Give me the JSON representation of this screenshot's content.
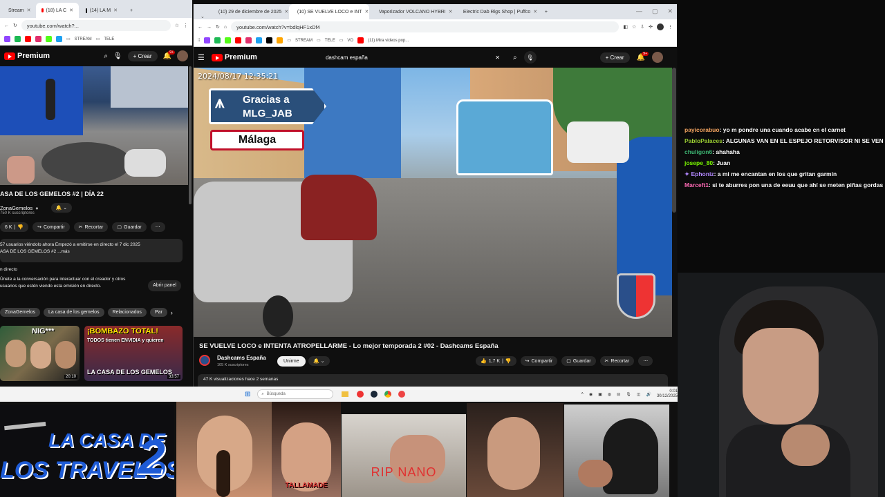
{
  "left_browser": {
    "tabs": [
      {
        "label": "Stream"
      },
      {
        "label": "(18) LA C"
      },
      {
        "label": "(14) LA M"
      }
    ],
    "url": "youtube.com/watch?...",
    "bookmarks": [
      "STREAM",
      "TELE"
    ],
    "header": {
      "logo": "Premium",
      "create_label": "Crear",
      "notif_count": "9+"
    },
    "video_title": "ASA DE LOS GEMELOS #2 | DÍA 22",
    "channel": {
      "name": "ZonaGemelos",
      "subs": "750 K suscriptores"
    },
    "actions": {
      "likes": "6 K",
      "share": "Compartir",
      "clip": "Recortar",
      "save": "Guardar"
    },
    "description": {
      "line1": "57 usuarios viéndolo ahora  Empezó a emitirse en directo el 7 dic 2025",
      "line2": "ASA DE LOS GEMELOS #2 ...más"
    },
    "live_chat": {
      "title": "n directo",
      "text": "Únete a la conversación para interactuar con el creador y otros usuarios que estén viendo esta emisión en directo.",
      "open": "Abrir panel"
    },
    "chips": [
      "ZonaGemelos",
      "La casa de los gemelos",
      "Relacionados",
      "Par"
    ],
    "thumbs": [
      {
        "overlay": "NIG***",
        "duration": "20:10"
      },
      {
        "overlay": "¡BOMBAZO TOTAL!",
        "sub": "TODOS tienen ENVIDIA y quieren",
        "bottom": "LA CASA DE LOS GEMELOS",
        "duration": "33:57"
      }
    ]
  },
  "right_browser": {
    "tabs": [
      {
        "label": "(10) 29 de diciembre de 2025"
      },
      {
        "label": "(10) SE VUELVE LOCO e INT"
      },
      {
        "label": "Vaporizador VOLCANO HYBRI"
      },
      {
        "label": "Electric Dab Rigs Shop | Puffco"
      }
    ],
    "url": "youtube.com/watch?v=bdlqHF1xDf4",
    "bookmarks": [
      "STREAM",
      "TELE",
      "VO",
      "(11) Mira videos pop..."
    ],
    "search_value": "dashcam españa",
    "header": {
      "logo": "Premium",
      "create_label": "Crear",
      "notif_count": "9+"
    },
    "video_overlay": {
      "timestamp": "2024/08/17  12:35:21",
      "thanks_line1": "Gracias a",
      "thanks_line2": "MLG_JAB",
      "city": "Málaga"
    },
    "video_title": "SE VUELVE LOCO e INTENTA ATROPELLARME - Lo mejor temporada 2 #02 - Dashcams España",
    "channel": {
      "name": "Dashcams España",
      "subs": "105 K suscriptores",
      "join": "Unirme"
    },
    "actions": {
      "likes": "1,7 K",
      "share": "Compartir",
      "save": "Guardar",
      "clip": "Recortar"
    },
    "meta": "47 K visualizaciones  hace 2 semanas"
  },
  "chat": [
    {
      "user": "payicorabuo",
      "color": "#f4a460",
      "msg": "yo m pondre una cuando acabe cn el carnet"
    },
    {
      "user": "PabloPalaces",
      "color": "#9acd32",
      "msg": "ALGUNAS VAN EN EL ESPEJO RETORVISOR NI SE VEN"
    },
    {
      "user": "chuligon6",
      "color": "#3cb371",
      "msg": "ahahaha"
    },
    {
      "user": "josepe_80",
      "color": "#7cfc00",
      "msg": "Juan"
    },
    {
      "user": "Ephoniz",
      "color": "#b388ff",
      "msg": "a mi me encantan en los que gritan garmin"
    },
    {
      "user": "Marceft1",
      "color": "#ff69b4",
      "msg": "si te aburres pon una de eeuu que ahí se meten piñas gordas"
    }
  ],
  "taskbar": {
    "search": "Búsqueda",
    "time": "0:01",
    "date": "30/12/2025"
  },
  "overlay": {
    "banner_line1": "LA CASA DE",
    "banner_line2": "LOS TRAVELOS",
    "banner_num": "2",
    "label1": "TALLAMADE",
    "label2": "RIP NANO"
  }
}
